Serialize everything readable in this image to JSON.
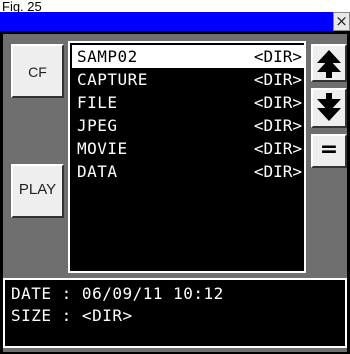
{
  "figure_label": "Fig. 25",
  "title_bar": {
    "close_symbol": "×"
  },
  "side_buttons": {
    "cf_label": "CF",
    "play_label": "PLAY"
  },
  "file_list": {
    "items": [
      {
        "name": "SAMP02",
        "type": "<DIR>",
        "selected": true
      },
      {
        "name": "CAPTURE",
        "type": "<DIR>",
        "selected": false
      },
      {
        "name": "FILE",
        "type": "<DIR>",
        "selected": false
      },
      {
        "name": "JPEG",
        "type": "<DIR>",
        "selected": false
      },
      {
        "name": "MOVIE",
        "type": "<DIR>",
        "selected": false
      },
      {
        "name": "DATA",
        "type": "<DIR>",
        "selected": false
      }
    ]
  },
  "scroll_buttons": {
    "up_symbol": "⯭",
    "down_symbol": "⯯",
    "enter_symbol": "="
  },
  "info": {
    "date_line": "DATE : 06/09/11 10:12",
    "size_line": "SIZE : <DIR>"
  },
  "colors": {
    "title_bar": "#0000ff",
    "panel_bg": "#6f6f6f",
    "list_bg": "#000000",
    "selection": "#ffffff"
  }
}
